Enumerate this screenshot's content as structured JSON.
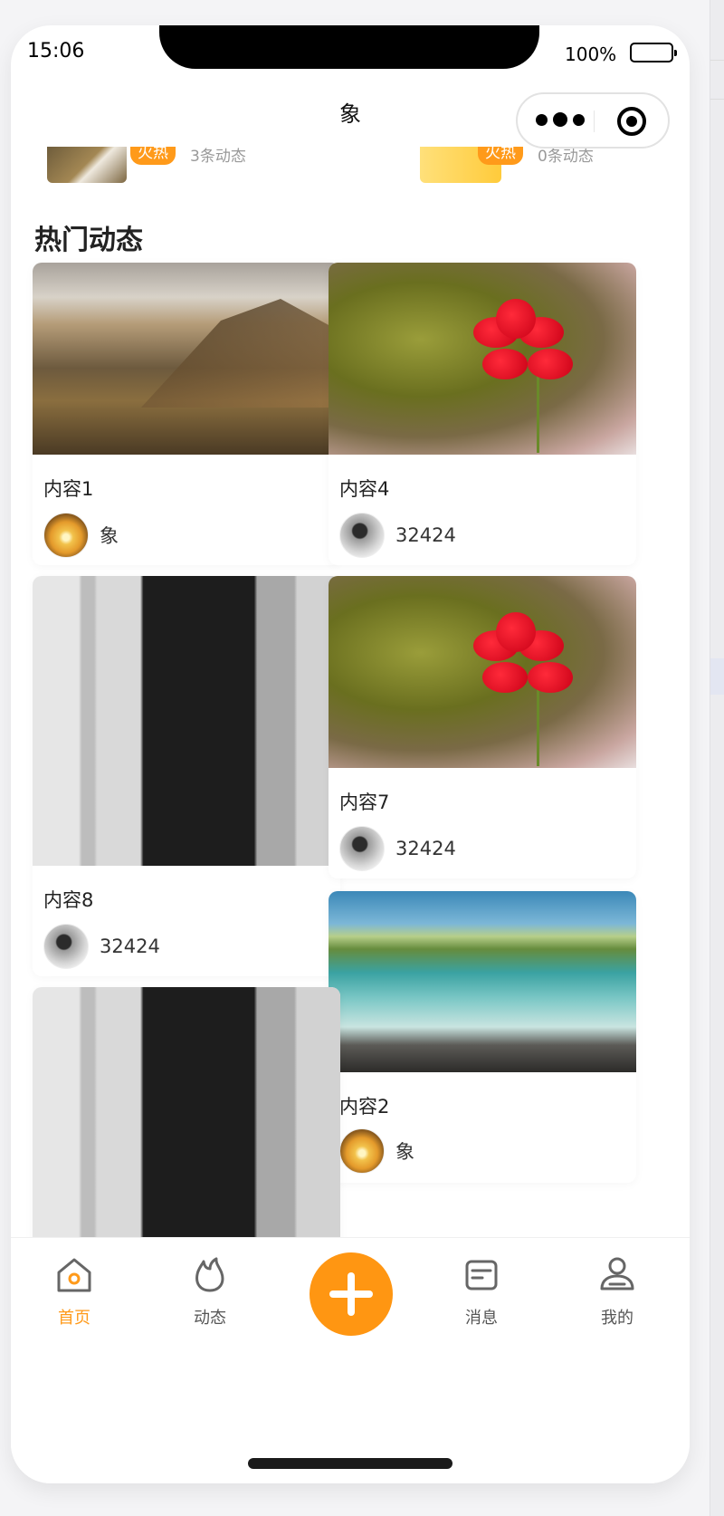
{
  "status": {
    "time": "15:06",
    "battery": "100%"
  },
  "navbar": {
    "title": "象"
  },
  "topics": [
    {
      "badge": "火热",
      "count": "3条动态"
    },
    {
      "badge": "火热",
      "count": "0条动态"
    }
  ],
  "section": {
    "title": "热门动态"
  },
  "posts": [
    {
      "title": "内容1",
      "author": "象",
      "image": "mountain-landscape",
      "avatar": "sunset"
    },
    {
      "title": "内容4",
      "author": "32424",
      "image": "red-flower",
      "avatar": "person"
    },
    {
      "title": "内容8",
      "author": "32424",
      "image": "person-sitting",
      "avatar": "person"
    },
    {
      "title": "内容7",
      "author": "32424",
      "image": "red-flower",
      "avatar": "person"
    },
    {
      "title": "内容2",
      "author": "象",
      "image": "coastline",
      "avatar": "sunset"
    },
    {
      "title": "",
      "author": "",
      "image": "person-sitting",
      "avatar": ""
    }
  ],
  "tabbar": {
    "items": [
      {
        "label": "首页",
        "icon": "home-icon",
        "active": true
      },
      {
        "label": "动态",
        "icon": "flame-icon",
        "active": false
      },
      {
        "label": "",
        "icon": "plus-icon",
        "active": false
      },
      {
        "label": "消息",
        "icon": "message-icon",
        "active": false
      },
      {
        "label": "我的",
        "icon": "profile-icon",
        "active": false
      }
    ]
  },
  "colors": {
    "accent": "#ff9612",
    "hot": "#ff9a1a",
    "text": "#222222"
  }
}
